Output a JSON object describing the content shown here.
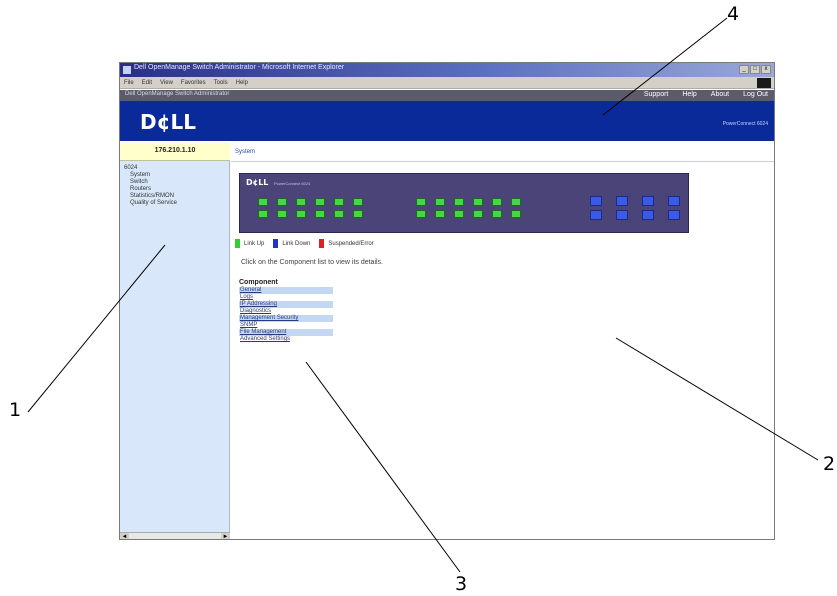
{
  "callouts": [
    "1",
    "2",
    "3",
    "4"
  ],
  "window": {
    "title": "Dell OpenManage Switch Administrator - Microsoft Internet Explorer",
    "controls": [
      "_",
      "□",
      "x"
    ]
  },
  "browser_menu": [
    "File",
    "Edit",
    "View",
    "Favorites",
    "Tools",
    "Help"
  ],
  "app_header": {
    "title": "Dell OpenManage Switch Administrator",
    "links": [
      "Support",
      "Help",
      "About",
      "Log Out"
    ]
  },
  "banner": {
    "logo": "D¢LL",
    "tagline": "PowerConnect 6024"
  },
  "sidebar": {
    "ip_address": "176.210.1.10",
    "tree": [
      {
        "label": "6024",
        "child": false
      },
      {
        "label": "System",
        "child": true
      },
      {
        "label": "Switch",
        "child": true
      },
      {
        "label": "Routers",
        "child": true
      },
      {
        "label": "Statistics/RMON",
        "child": true
      },
      {
        "label": "Quality of Service",
        "child": true
      }
    ],
    "scroll_left": "◄",
    "scroll_right": "►"
  },
  "main": {
    "breadcrumb": "System",
    "faceplate_logo": "D¢LL",
    "faceplate_model": "PowerConnect 6024",
    "legend": [
      {
        "label": "Link Up",
        "color": "#33cc33"
      },
      {
        "label": "Link Down",
        "color": "#2233cc"
      },
      {
        "label": "Suspended/Error",
        "color": "#dd2222"
      }
    ],
    "instruction": "Click on the Component list to view its details.",
    "components_header": "Component",
    "components": [
      "General",
      "Logs",
      "IP Addressing",
      "Diagnostics",
      "Management Security",
      "SNMP",
      "File Management",
      "Advanced Settings"
    ]
  },
  "colors": {
    "banner": "#0a2a9a",
    "sidebar": "#d8e8fa",
    "port_up": "#44d844",
    "port_down": "#3a5ae8"
  }
}
